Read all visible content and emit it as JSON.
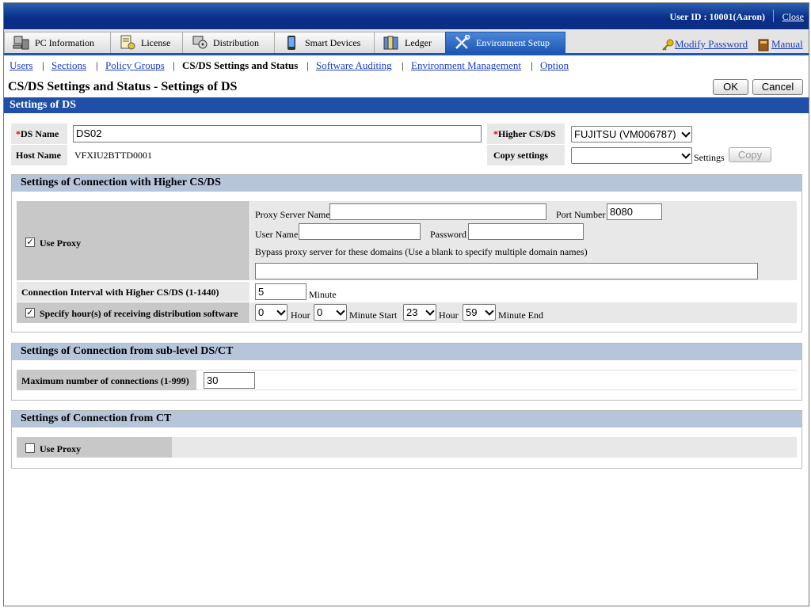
{
  "header": {
    "user_id": "User ID : 10001(Aaron)",
    "close": "Close"
  },
  "tabs": [
    {
      "label": "PC Information",
      "icon": "pc-icon"
    },
    {
      "label": "License",
      "icon": "license-icon"
    },
    {
      "label": "Distribution",
      "icon": "distribution-icon"
    },
    {
      "label": "Smart Devices",
      "icon": "smart-device-icon"
    },
    {
      "label": "Ledger",
      "icon": "ledger-icon"
    },
    {
      "label": "Environment Setup",
      "icon": "tools-icon"
    }
  ],
  "top_links": {
    "modify_password": "Modify Password",
    "manual": "Manual"
  },
  "subnav": {
    "users": "Users",
    "sections": "Sections",
    "policy_groups": "Policy Groups",
    "current": "CS/DS Settings and Status",
    "software_auditing": "Software Auditing",
    "environment_management": "Environment Management",
    "option": "Option"
  },
  "page": {
    "title": "CS/DS Settings and Status - Settings of DS",
    "ok": "OK",
    "cancel": "Cancel",
    "section_title": "Settings of DS"
  },
  "ds": {
    "ds_name_label": "DS Name",
    "ds_name_value": "DS02",
    "host_name_label": "Host Name",
    "host_name_value": "VFXIU2BTTD0001",
    "higher_label": "Higher CS/DS",
    "higher_value": "FUJITSU (VM006787)",
    "copy_label": "Copy settings",
    "copy_value": "",
    "settings_text": "Settings",
    "copy_button": "Copy"
  },
  "higher_conn": {
    "title": "Settings of Connection with Higher CS/DS",
    "use_proxy": "Use Proxy",
    "use_proxy_checked": true,
    "proxy_server_label": "Proxy Server Name",
    "proxy_server_value": "",
    "port_label": "Port Number",
    "port_value": "8080",
    "user_label": "User Name",
    "user_value": "",
    "password_label": "Password",
    "password_value": "",
    "bypass_label": "Bypass proxy server for these domains (Use a blank to specify multiple domain names)",
    "bypass_value": "",
    "interval_label": "Connection Interval with Higher CS/DS (1-1440)",
    "interval_value": "5",
    "minute": "Minute",
    "hours_label": "Specify hour(s) of receiving distribution software",
    "hours_checked": true,
    "start_hour": "0",
    "hour_text": "Hour",
    "start_minute": "0",
    "minute_start": "Minute Start",
    "end_hour": "23",
    "hour_text2": "Hour",
    "end_minute": "59",
    "minute_end": "Minute End"
  },
  "sub_conn": {
    "title": "Settings of Connection from sub-level DS/CT",
    "max_label": "Maximum number of connections (1-999)",
    "max_value": "30"
  },
  "ct_conn": {
    "title": "Settings of Connection from CT",
    "use_proxy": "Use Proxy",
    "use_proxy_checked": false
  }
}
